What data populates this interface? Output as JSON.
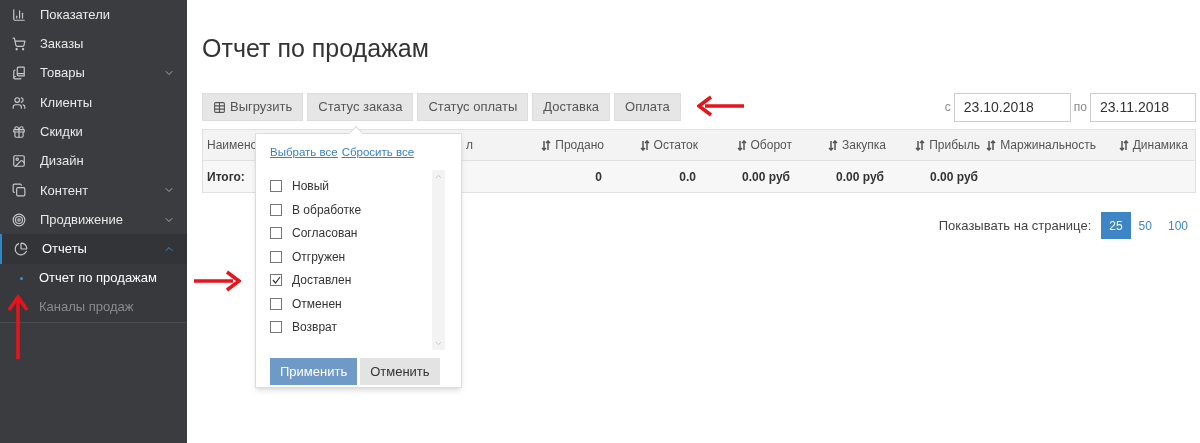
{
  "sidebar": {
    "items": [
      {
        "label": "Показатели",
        "selected": false
      },
      {
        "label": "Заказы",
        "selected": false
      },
      {
        "label": "Товары",
        "selected": false,
        "expanded": false
      },
      {
        "label": "Клиенты",
        "selected": false
      },
      {
        "label": "Скидки",
        "selected": false
      },
      {
        "label": "Дизайн",
        "selected": false
      },
      {
        "label": "Контент",
        "selected": false,
        "expanded": false
      },
      {
        "label": "Продвижение",
        "selected": false,
        "expanded": false
      },
      {
        "label": "Отчеты",
        "selected": true,
        "expanded": true,
        "children": [
          {
            "label": "Отчет по продажам",
            "selected": true
          },
          {
            "label": "Каналы продаж",
            "selected": false
          }
        ]
      }
    ]
  },
  "page": {
    "title": "Отчет по продажам"
  },
  "toolbar": {
    "buttons": [
      {
        "label": "Выгрузить"
      },
      {
        "label": "Статус заказа"
      },
      {
        "label": "Статус оплаты"
      },
      {
        "label": "Доставка"
      },
      {
        "label": "Оплата"
      }
    ],
    "date_from": {
      "label": "с",
      "value": "23.10.2018"
    },
    "date_to": {
      "label": "по",
      "value": "23.11.2018"
    }
  },
  "table": {
    "columns": [
      {
        "label": "Наимено",
        "sortable": false
      },
      {
        "label": "л",
        "sortable": false
      },
      {
        "label": "Продано",
        "sortable": true
      },
      {
        "label": "Остаток",
        "sortable": true
      },
      {
        "label": "Оборот",
        "sortable": true
      },
      {
        "label": "Закупка",
        "sortable": true
      },
      {
        "label": "Прибыль",
        "sortable": true
      },
      {
        "label": "Маржинальность",
        "sortable": true
      },
      {
        "label": "Динамика",
        "sortable": true
      }
    ],
    "total_row": {
      "label": "Итого:",
      "cells": [
        "0",
        "0.0",
        "0.00 руб",
        "0.00 руб",
        "0.00 руб"
      ]
    }
  },
  "pagination": {
    "label": "Показывать на странице:",
    "options": [
      {
        "label": "25",
        "selected": true
      },
      {
        "label": "50",
        "selected": false
      },
      {
        "label": "100",
        "selected": false
      }
    ]
  },
  "status_popup": {
    "select_all": "Выбрать все",
    "reset_all": "Сбросить все",
    "options": [
      {
        "label": "Новый",
        "checked": false
      },
      {
        "label": "В обработке",
        "checked": false
      },
      {
        "label": "Согласован",
        "checked": false
      },
      {
        "label": "Отгружен",
        "checked": false
      },
      {
        "label": "Доставлен",
        "checked": true
      },
      {
        "label": "Отменен",
        "checked": false
      },
      {
        "label": "Возврат",
        "checked": false
      }
    ],
    "apply": "Применить",
    "cancel": "Отменить"
  }
}
